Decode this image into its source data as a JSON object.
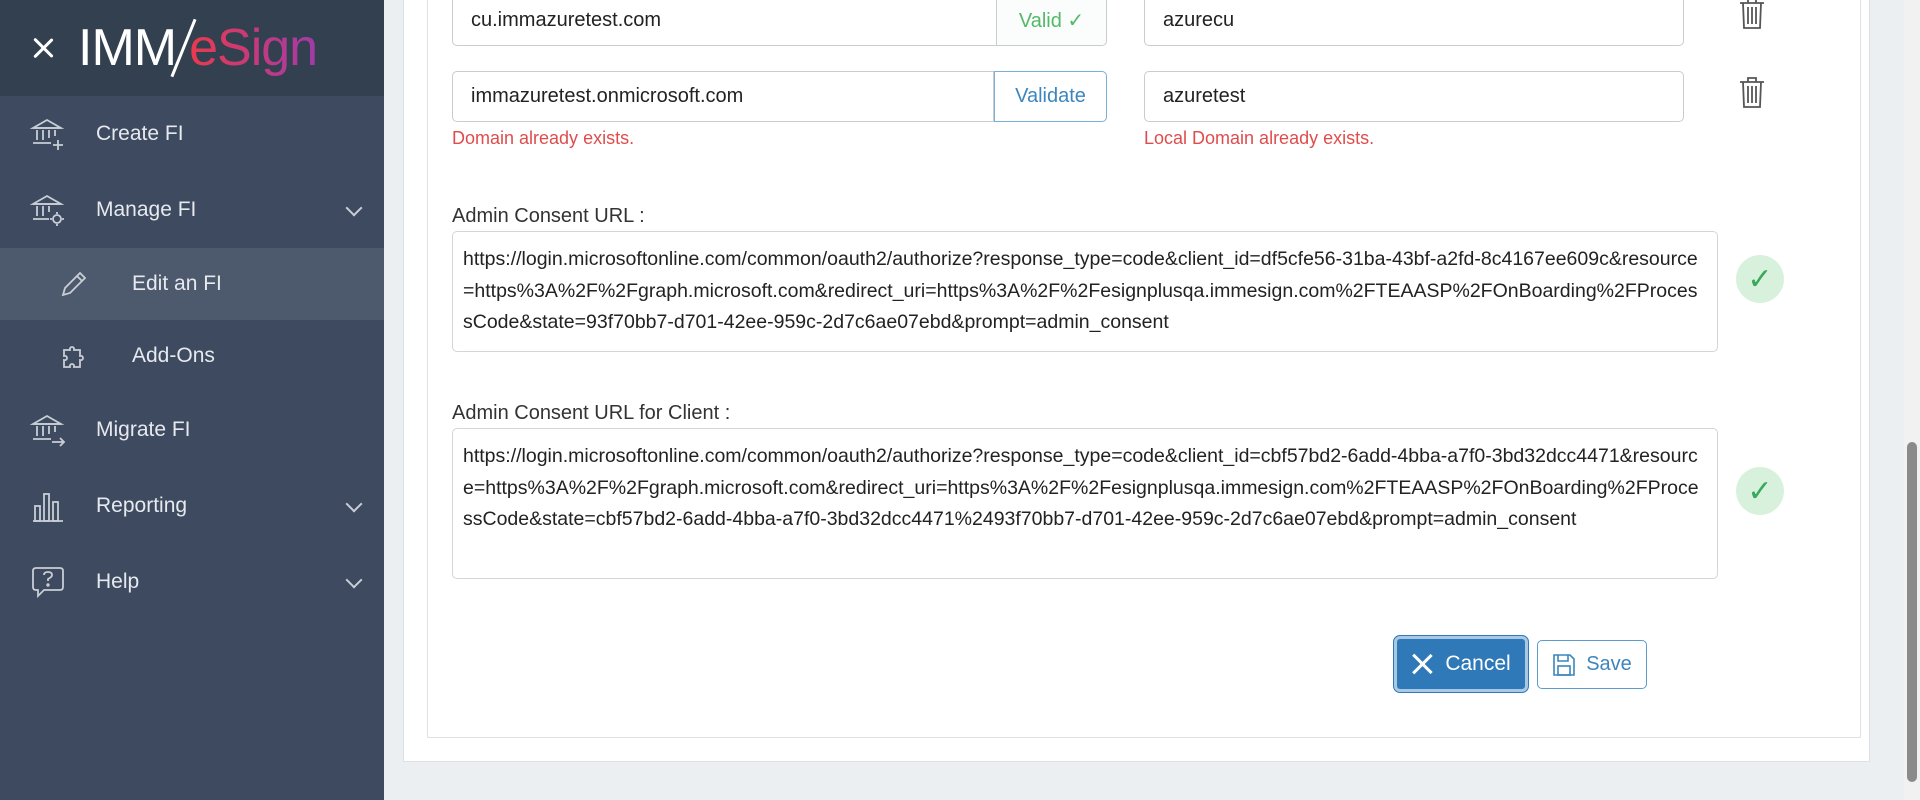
{
  "sidebar": {
    "logo": {
      "part1": "IMM",
      "part2": "eSign"
    },
    "items": [
      {
        "label": "Create FI",
        "icon": "bank-plus-icon"
      },
      {
        "label": "Manage FI",
        "icon": "bank-gear-icon"
      },
      {
        "label": "Edit an FI",
        "icon": "pencil-icon"
      },
      {
        "label": "Add-Ons",
        "icon": "puzzle-icon"
      },
      {
        "label": "Migrate FI",
        "icon": "bank-arrow-icon"
      },
      {
        "label": "Reporting",
        "icon": "bar-chart-icon"
      },
      {
        "label": "Help",
        "icon": "help-bubble-icon"
      }
    ]
  },
  "domains": [
    {
      "domain": "cu.immazuretest.com",
      "status": "Valid ✓",
      "local_domain": "azurecu"
    },
    {
      "domain": "immazuretest.onmicrosoft.com",
      "status": "Validate",
      "local_domain": "azuretest",
      "domain_error": "Domain already exists.",
      "local_error": "Local Domain already exists."
    }
  ],
  "admin_consent": {
    "label": "Admin Consent URL :",
    "url": "https://login.microsoftonline.com/common/oauth2/authorize?response_type=code&client_id=df5cfe56-31ba-43bf-a2fd-8c4167ee609c&resource=https%3A%2F%2Fgraph.microsoft.com&redirect_uri=https%3A%2F%2Fesignplusqa.immesign.com%2FTEAASP%2FOnBoarding%2FProcessCode&state=93f70bb7-d701-42ee-959c-2d7c6ae07ebd&prompt=admin_consent"
  },
  "admin_consent_client": {
    "label": "Admin Consent URL for Client :",
    "url": "https://login.microsoftonline.com/common/oauth2/authorize?response_type=code&client_id=cbf57bd2-6add-4bba-a7f0-3bd32dcc4471&resource=https%3A%2F%2Fgraph.microsoft.com&redirect_uri=https%3A%2F%2Fesignplusqa.immesign.com%2FTEAASP%2FOnBoarding%2FProcessCode&state=cbf57bd2-6add-4bba-a7f0-3bd32dcc4471%2493f70bb7-d701-42ee-959c-2d7c6ae07ebd&prompt=admin_consent"
  },
  "check_glyph": "✓",
  "buttons": {
    "cancel": "Cancel",
    "save": "Save"
  },
  "colors": {
    "sidebar_bg": "#3d4a5f",
    "primary": "#2f79b9",
    "error": "#e04c4c",
    "valid": "#52b96a"
  }
}
